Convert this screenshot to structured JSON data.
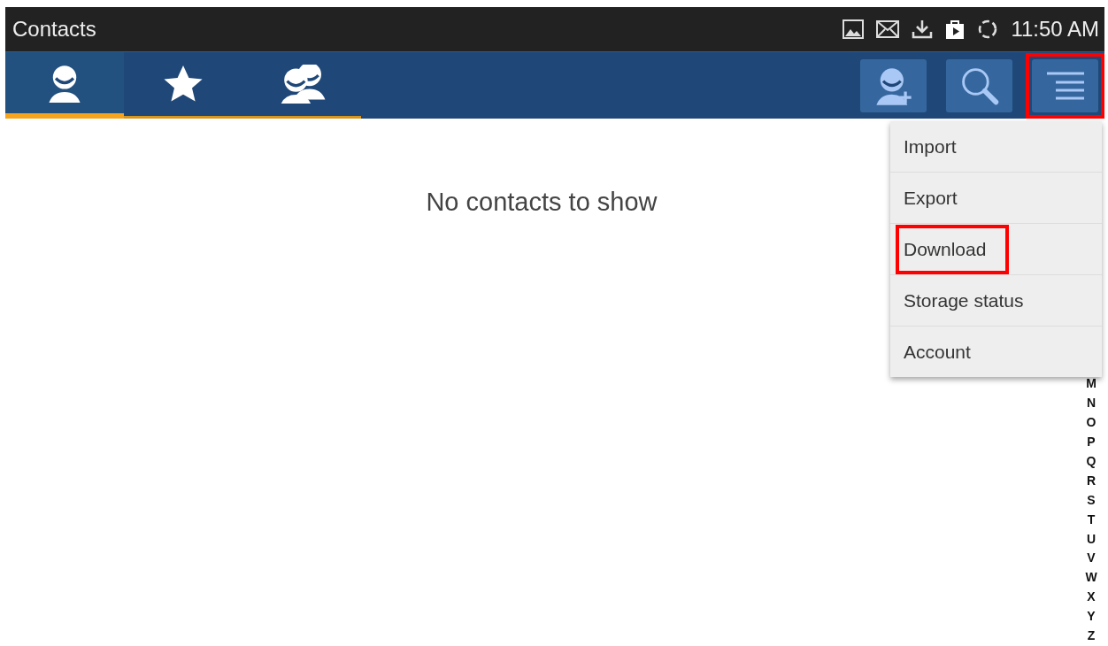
{
  "status_bar": {
    "title": "Contacts",
    "time": "11:50 AM"
  },
  "tabs": [
    {
      "kind": "person",
      "selected": true
    },
    {
      "kind": "star",
      "selected": false
    },
    {
      "kind": "group",
      "selected": false
    }
  ],
  "actions": [
    {
      "kind": "add-contact",
      "highlighted": false
    },
    {
      "kind": "search",
      "highlighted": false
    },
    {
      "kind": "menu",
      "highlighted": true
    }
  ],
  "empty_message": "No contacts to show",
  "menu": [
    {
      "label": "Import",
      "highlighted": false
    },
    {
      "label": "Export",
      "highlighted": false
    },
    {
      "label": "Download",
      "highlighted": true
    },
    {
      "label": "Storage status",
      "highlighted": false
    },
    {
      "label": "Account",
      "highlighted": false
    }
  ],
  "index_letters": [
    "M",
    "N",
    "O",
    "P",
    "Q",
    "R",
    "S",
    "T",
    "U",
    "V",
    "W",
    "X",
    "Y",
    "Z"
  ]
}
